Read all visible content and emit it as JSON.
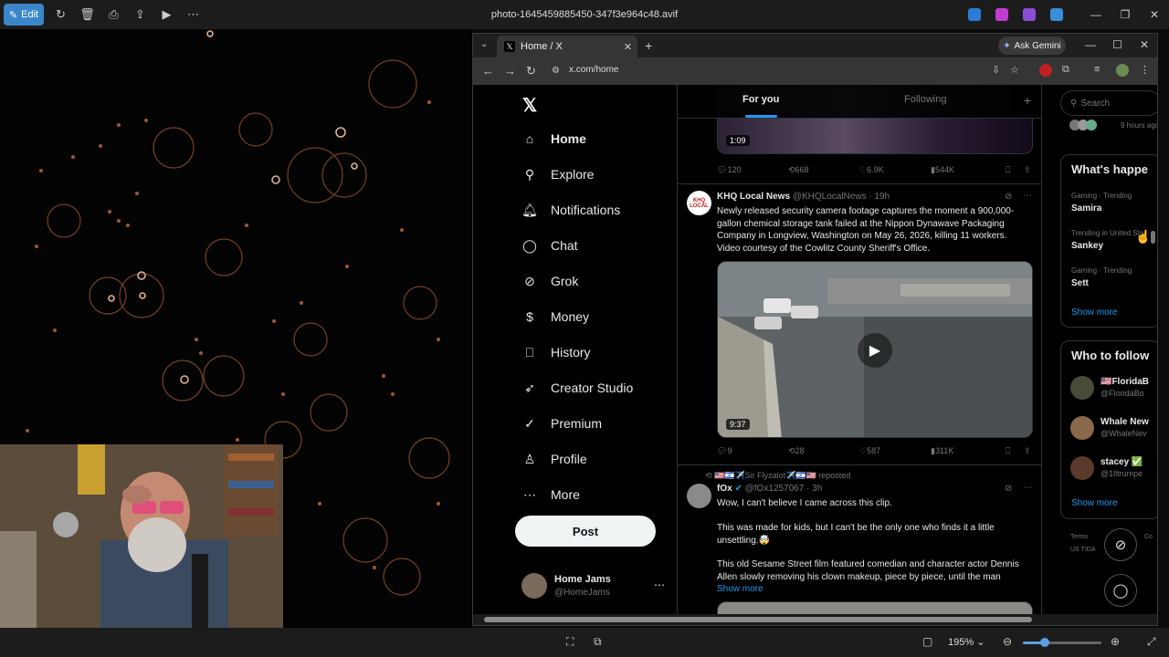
{
  "viewer": {
    "edit_label": "Edit",
    "file_title": "photo-1645459885450-347f3e964c48.avif",
    "zoom": "195%",
    "zoom_level": 0.28
  },
  "browser": {
    "tab_title": "Home / X",
    "ask_gemini": "Ask Gemini",
    "url": "x.com/home"
  },
  "nav": {
    "items": [
      {
        "label": "Home",
        "icon": "home-icon"
      },
      {
        "label": "Explore",
        "icon": "search-icon"
      },
      {
        "label": "Notifications",
        "icon": "bell-icon"
      },
      {
        "label": "Chat",
        "icon": "chat-icon"
      },
      {
        "label": "Grok",
        "icon": "grok-icon"
      },
      {
        "label": "Money",
        "icon": "money-icon"
      },
      {
        "label": "History",
        "icon": "bookmark-icon"
      },
      {
        "label": "Creator Studio",
        "icon": "rocket-icon"
      },
      {
        "label": "Premium",
        "icon": "premium-icon"
      },
      {
        "label": "Profile",
        "icon": "person-icon"
      },
      {
        "label": "More",
        "icon": "more-icon"
      }
    ],
    "post_label": "Post",
    "account_name": "Home Jams",
    "account_handle": "@HomeJams"
  },
  "timeline": {
    "tab_for_you": "For you",
    "tab_following": "Following",
    "first_video_duration": "1:09",
    "first_actions": {
      "replies": "120",
      "reposts": "668",
      "likes": "6.9K",
      "views": "544K"
    },
    "tweet2": {
      "name": "KHQ Local News",
      "handle_time": "@KHQLocalNews · 19h",
      "avatar_text": "KHQ LOCAL",
      "text": "Newly released security camera footage captures the moment a 900,000-gallon chemical storage tank failed at the Nippon Dynawave Packaging Company in Longview, Washington on May 26, 2026, killing 11 workers. Video courtesy of the Cowlitz County Sheriff's Office.",
      "video_duration": "9:37",
      "actions": {
        "replies": "9",
        "reposts": "28",
        "likes": "587",
        "views": "311K"
      }
    },
    "tweet3": {
      "repost_line": "🇺🇸🇮🇱✈️Sir Flyzalot✈️🇮🇱🇺🇸 reposted",
      "name": "fOx",
      "handle_time": "@fOx1257067 · 3h",
      "para1": "Wow, I can't believe I came across this clip.",
      "para2": "This was made for kids, but I can't be the only one who finds it a little unsettling.🤯",
      "para3": "This old Sesame Street film featured comedian and character actor Dennis Allen slowly removing his clown makeup, piece by piece, until the man",
      "show_more": "Show more"
    }
  },
  "sidebar": {
    "search_placeholder": "Search",
    "hours_ago": "9 hours ago",
    "whats_happening": "What's happe",
    "trends": [
      {
        "meta": "Gaming · Trending",
        "name": "Samira"
      },
      {
        "meta": "Trending in United Sta",
        "name": "Sankey"
      },
      {
        "meta": "Gaming · Trending",
        "name": "Sett"
      }
    ],
    "show_more": "Show more",
    "who_to_follow": "Who to follow",
    "follow": [
      {
        "name": "🇺🇸FloridaB",
        "handle": "@FloridaBo"
      },
      {
        "name": "Whale New",
        "handle": "@WhaleNev"
      },
      {
        "name": "stacey ✅",
        "handle": "@1lltrumpe"
      }
    ],
    "show_more2": "Show more",
    "footer_terms": "Terms",
    "footer_tida": "US TIDA",
    "footer_co": "Co"
  },
  "colors": {
    "accent": "#1d9bf0",
    "edit_button": "#3a86c8",
    "bg": "#000000"
  }
}
